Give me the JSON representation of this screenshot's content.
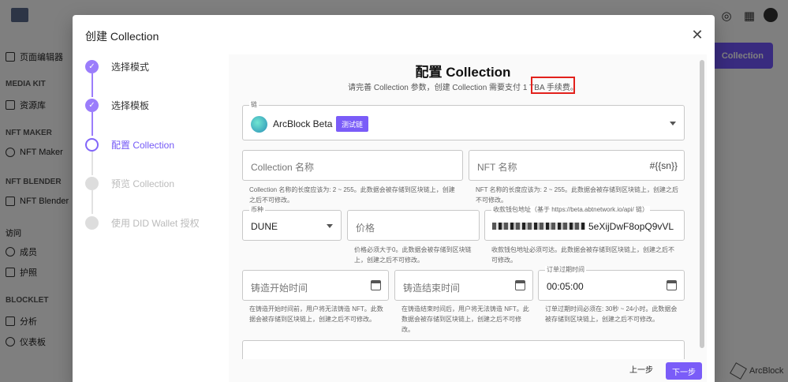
{
  "background": {
    "sidebar": {
      "items": [
        {
          "label": "页面编辑器",
          "section": ""
        },
        {
          "label": "资源库",
          "section": "MEDIA KIT"
        },
        {
          "label": "NFT Maker",
          "section": "NFT MAKER"
        },
        {
          "label": "NFT Blender",
          "section": "NFT BLENDER"
        },
        {
          "label": "成员",
          "section": "访问"
        },
        {
          "label": "护照",
          "section": ""
        },
        {
          "label": "分析",
          "section": "BLOCKLET"
        },
        {
          "label": "仪表板",
          "section": ""
        }
      ],
      "sections": [
        "MEDIA KIT",
        "NFT MAKER",
        "NFT BLENDER",
        "访问",
        "BLOCKLET"
      ]
    },
    "header_button": "Collection",
    "brand": "ArcBlock",
    "footer_fragment": "y"
  },
  "dialog": {
    "title": "创建 Collection",
    "steps": [
      {
        "label": "选择模式",
        "state": "done"
      },
      {
        "label": "选择模板",
        "state": "done"
      },
      {
        "label": "配置 Collection",
        "state": "active"
      },
      {
        "label": "预览 Collection",
        "state": "todo"
      },
      {
        "label": "使用 DID Wallet 授权",
        "state": "todo"
      }
    ],
    "heading": "配置 Collection",
    "subheading": "请完善 Collection 参数，创建 Collection 需要支付 1 TBA 手续费。",
    "chain": {
      "label": "链",
      "value": "ArcBlock Beta",
      "badge": "测试链"
    },
    "collection_name": {
      "placeholder": "Collection 名称",
      "help": "Collection 名称的长度应该为: 2 ~ 255。此数据会被存储到区块链上，创建之后不可修改。"
    },
    "nft_name": {
      "placeholder": "NFT 名称",
      "suffix": "#{{sn}}",
      "help": "NFT 名称的长度应该为: 2 ~ 255。此数据会被存储到区块链上，创建之后不可修改。"
    },
    "currency": {
      "label": "币种",
      "value": "DUNE"
    },
    "price": {
      "placeholder": "价格",
      "help": "价格必须大于0。此数据会被存储到区块链上，创建之后不可修改。"
    },
    "wallet": {
      "label": "收款钱包地址（基于 https://beta.abtnetwork.io/api/ 链）",
      "value_visible": "5eXijDwF8opQ9vVL",
      "help": "收款钱包地址必须可达。此数据会被存储到区块链上，创建之后不可修改。"
    },
    "mint_start": {
      "placeholder": "铸造开始时间",
      "help": "在铸造开始时间前，用户将无法铸造 NFT。此数据会被存储到区块链上，创建之后不可修改。"
    },
    "mint_end": {
      "placeholder": "铸造结束时间",
      "help": "在铸造结束时间后，用户将无法铸造 NFT。此数据会被存储到区块链上，创建之后不可修改。"
    },
    "order_expiry": {
      "label": "订单过期时间",
      "value": "00:05:00",
      "help": "订单过期时间必须在: 30秒 ~ 24小时。此数据会被存储到区块链上，创建之后不可修改。"
    },
    "prev_label": "上一步",
    "next_label": "下一步"
  },
  "colors": {
    "accent": "#7a5cf8",
    "highlight_box": "#e2211c"
  }
}
